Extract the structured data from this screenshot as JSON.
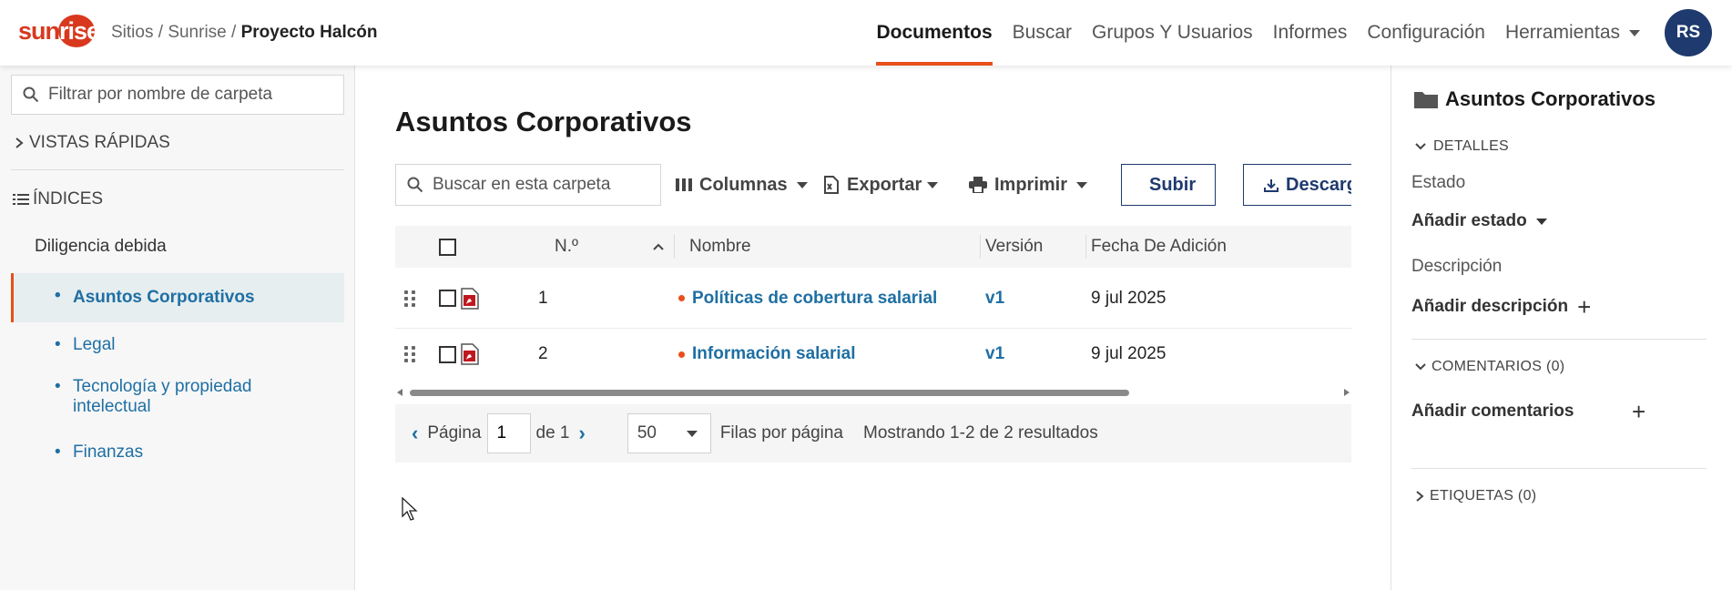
{
  "header": {
    "logo_text_a": "sun",
    "logo_text_b": "rise",
    "breadcrumb": {
      "part1": "Sitios",
      "sep1": " / ",
      "part2": "Sunrise",
      "sep2": " / ",
      "current": "Proyecto Halcón"
    },
    "nav": [
      {
        "label": "Documentos",
        "active": true
      },
      {
        "label": "Buscar"
      },
      {
        "label": "Grupos Y Usuarios"
      },
      {
        "label": "Informes"
      },
      {
        "label": "Configuración"
      },
      {
        "label": "Herramientas"
      }
    ],
    "avatar_initials": "RS",
    "accent_color": "#e94e1b",
    "brand_color": "#d8391e"
  },
  "sidebar": {
    "filter_placeholder": "Filtrar por nombre de carpeta",
    "quick_views": "VISTAS RÁPIDAS",
    "indexes": "ÍNDICES",
    "root": "Diligencia debida",
    "items": [
      {
        "label": "Asuntos Corporativos",
        "active": true
      },
      {
        "label": "Legal"
      },
      {
        "label": "Tecnología y propiedad intelectual"
      },
      {
        "label": "Finanzas"
      }
    ]
  },
  "main": {
    "title": "Asuntos Corporativos",
    "search_placeholder": "Buscar en esta carpeta",
    "toolbar": {
      "columns": "Columnas",
      "export": "Exportar",
      "print": "Imprimir",
      "upload": "Subir",
      "download": "Descargar"
    },
    "table": {
      "headers": {
        "number": "N.º",
        "name": "Nombre",
        "version": "Versión",
        "date": "Fecha De Adición"
      },
      "rows": [
        {
          "number": "1",
          "name": "Políticas de cobertura salarial",
          "version": "v1",
          "date": "9 jul 2025",
          "file_icon": "pdf-icon"
        },
        {
          "number": "2",
          "name": "Información salarial",
          "version": "v1",
          "date": "9 jul 2025",
          "file_icon": "pdf-icon"
        }
      ]
    },
    "pagination": {
      "page_label": "Página",
      "page_value": "1",
      "of_label": "de 1",
      "rows_value": "50",
      "rows_label": "Filas por página",
      "results": "Mostrando 1-2 de 2 resultados"
    }
  },
  "right_panel": {
    "title": "Asuntos Corporativos",
    "details": "DETALLES",
    "status_label": "Estado",
    "status_action": "Añadir estado",
    "description_label": "Descripción",
    "description_action": "Añadir descripción",
    "comments": "COMENTARIOS (0)",
    "comments_action": "Añadir comentarios",
    "tags": "ETIQUETAS (0)"
  }
}
